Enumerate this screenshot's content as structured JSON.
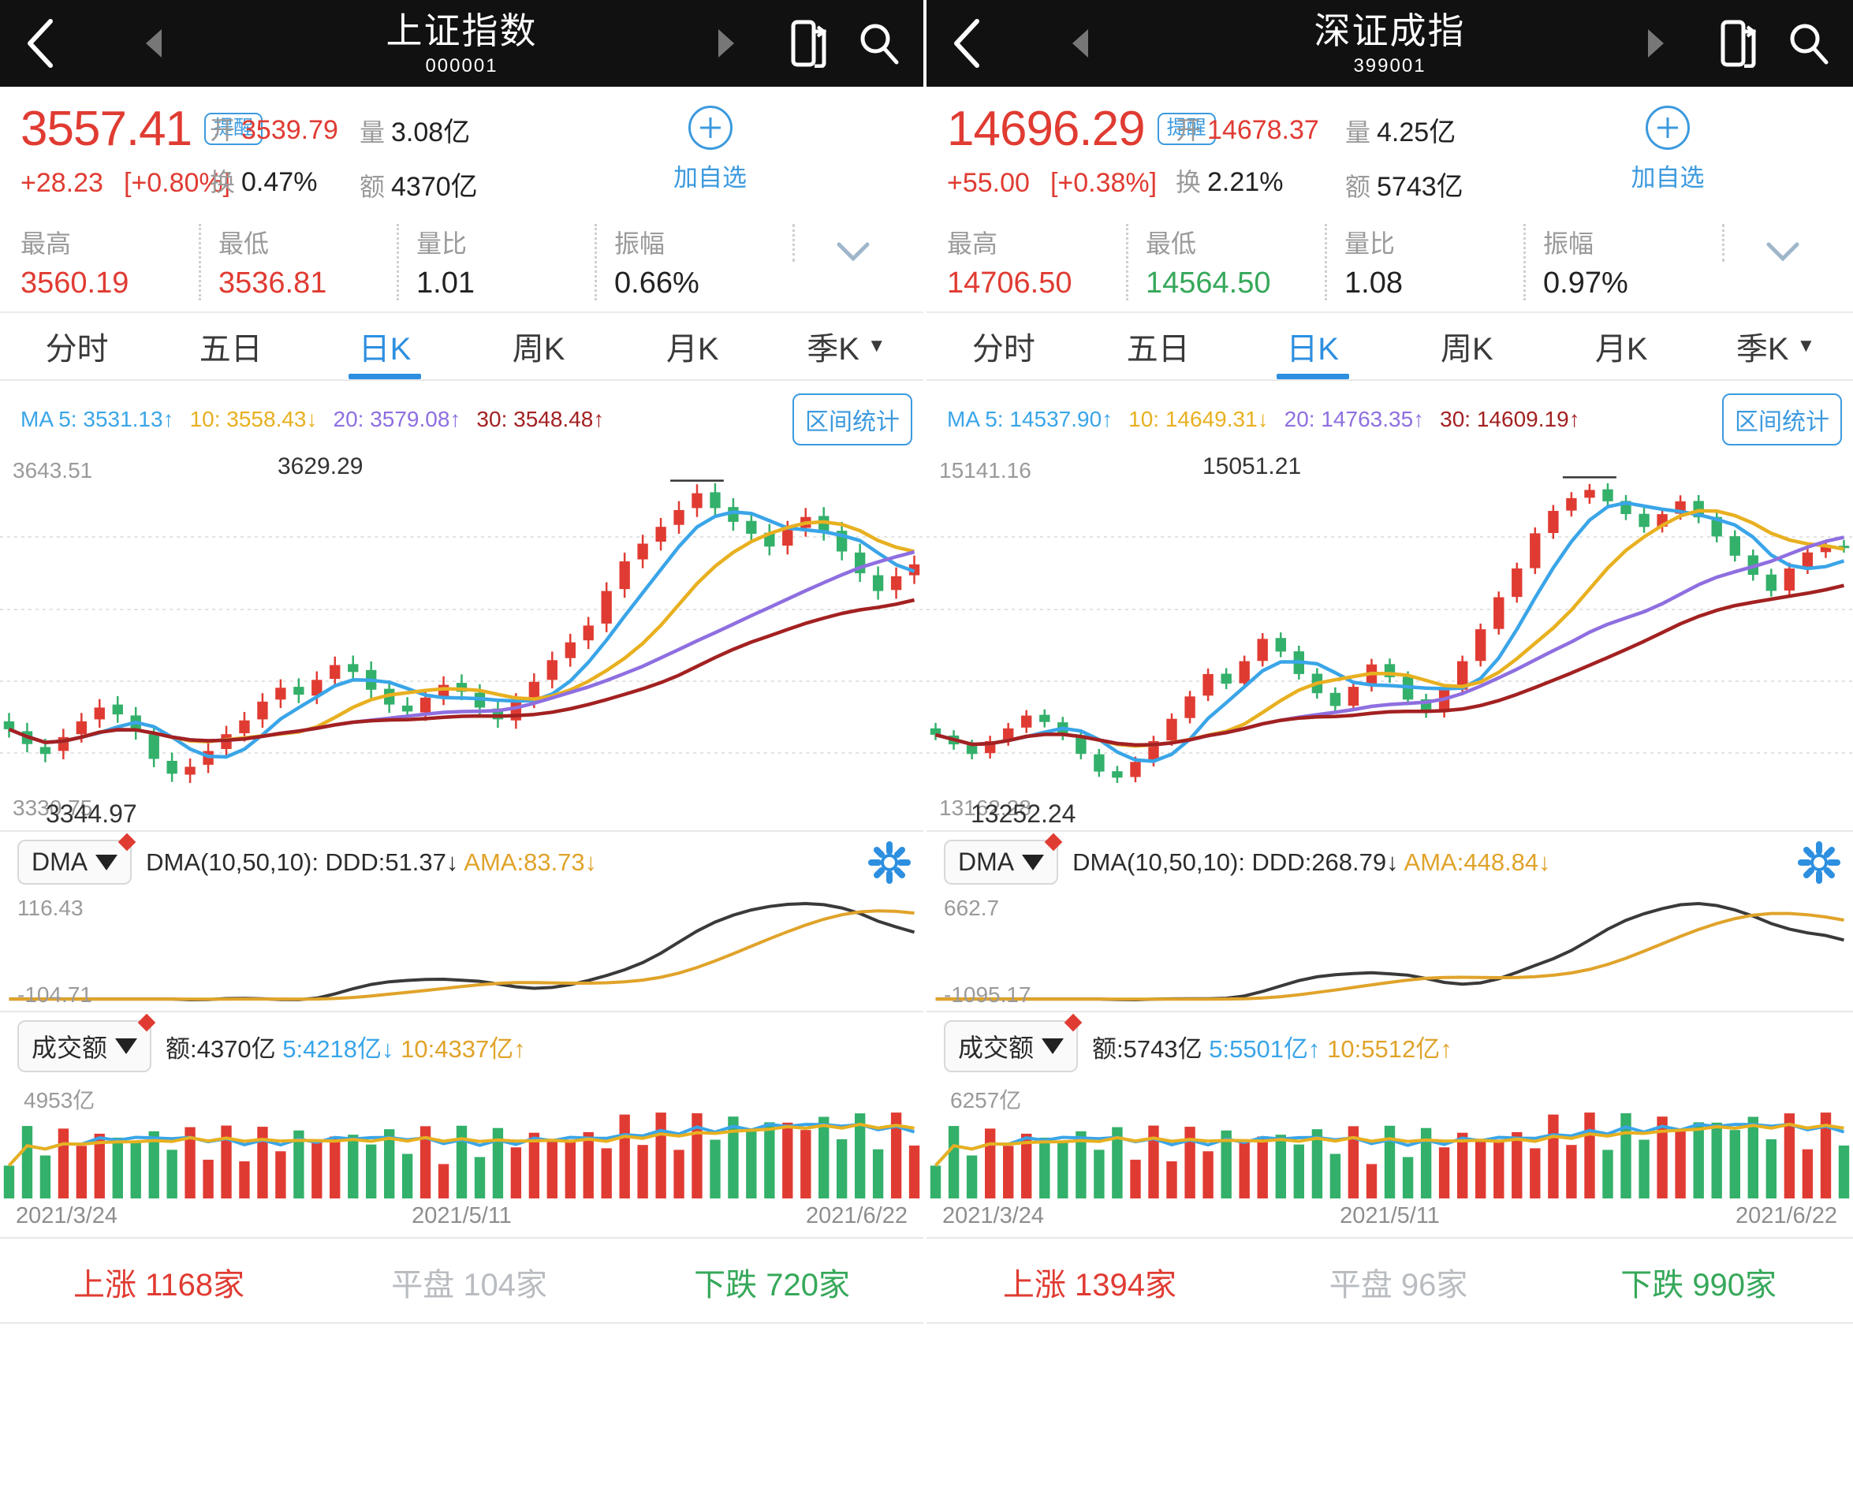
{
  "panels": [
    {
      "header": {
        "title": "上证指数",
        "code": "000001",
        "back_icon": "back-chevron-icon",
        "prev_icon": "prev-arrow-icon",
        "next_icon": "next-arrow-icon",
        "phone_icon": "phone-share-icon",
        "search_icon": "search-icon"
      },
      "quote": {
        "price": "3557.41",
        "alert_label": "提醒",
        "change": "+28.23",
        "change_pct": "[+0.80%]",
        "open_label": "开",
        "open_value": "3539.79",
        "turnover_label": "换",
        "turnover_value": "0.47%",
        "volume_label": "量",
        "volume_value": "3.08亿",
        "amount_label": "额",
        "amount_value": "4370亿",
        "add_label": "加自选",
        "color_up": "#e03b32",
        "color_down": "#36a85a"
      },
      "stats": [
        {
          "label": "最高",
          "value": "3560.19",
          "color": "red"
        },
        {
          "label": "最低",
          "value": "3536.81",
          "color": "red"
        },
        {
          "label": "量比",
          "value": "1.01",
          "color": "dark"
        },
        {
          "label": "振幅",
          "value": "0.66%",
          "color": "dark"
        }
      ],
      "tabs": [
        {
          "label": "分时",
          "active": false
        },
        {
          "label": "五日",
          "active": false
        },
        {
          "label": "日K",
          "active": true
        },
        {
          "label": "周K",
          "active": false
        },
        {
          "label": "月K",
          "active": false
        },
        {
          "label": "季K",
          "active": false,
          "caret": "▼"
        }
      ],
      "ma": {
        "ma5": "MA 5: 3531.13↑",
        "ma10": "10: 3558.43↓",
        "ma20": "20: 3579.08↑",
        "ma30": "30: 3548.48↑",
        "range_button": "区间统计"
      },
      "kchart": {
        "top_label": "3643.51",
        "bottom_label": "3330.75",
        "peak_label": "3629.29",
        "low_label": "3344.97"
      },
      "dma": {
        "button": "DMA",
        "text_prefix": "DMA(10,50,10):  DDD:51.37↓",
        "ama": "AMA:83.73↓",
        "top_label": "116.43",
        "bottom_label": "-104.71",
        "gear_icon": "gear-icon"
      },
      "volume": {
        "button": "成交额",
        "total": "额:4370亿",
        "v5": "5:4218亿↓",
        "v10": "10:4337亿↑",
        "top_label": "4953亿"
      },
      "dates": [
        "2021/3/24",
        "2021/5/11",
        "2021/6/22"
      ],
      "breadth": {
        "up": "上涨  1168家",
        "flat": "平盘  104家",
        "down": "下跌  720家"
      },
      "chart_data": {
        "type": "candlestick",
        "title": "上证指数 日K",
        "ylim": [
          3330.75,
          3643.51
        ],
        "xlabels": [
          "2021/3/24",
          "2021/5/11",
          "2021/6/22"
        ],
        "annotations": {
          "peak": 3629.29,
          "trough": 3344.97
        },
        "series": [
          {
            "name": "MA5",
            "color": "#3aa5e8",
            "last": 3531.13
          },
          {
            "name": "MA10",
            "color": "#e8b020",
            "last": 3558.43
          },
          {
            "name": "MA20",
            "color": "#8e6fe0",
            "last": 3579.08
          },
          {
            "name": "MA30",
            "color": "#a32121",
            "last": 3548.48
          }
        ],
        "closes": [
          3390,
          3375,
          3365,
          3382,
          3398,
          3412,
          3405,
          3388,
          3360,
          3345,
          3352,
          3368,
          3385,
          3399,
          3418,
          3432,
          3425,
          3440,
          3455,
          3448,
          3430,
          3415,
          3408,
          3422,
          3435,
          3428,
          3412,
          3400,
          3418,
          3438,
          3460,
          3478,
          3495,
          3530,
          3560,
          3578,
          3595,
          3612,
          3629,
          3614,
          3600,
          3588,
          3575,
          3592,
          3605,
          3590,
          3570,
          3548,
          3530,
          3545,
          3557
        ],
        "opens": [
          3398,
          3388,
          3372,
          3368,
          3385,
          3400,
          3415,
          3404,
          3385,
          3358,
          3344,
          3354,
          3370,
          3386,
          3400,
          3420,
          3433,
          3424,
          3441,
          3456,
          3450,
          3431,
          3414,
          3407,
          3423,
          3437,
          3427,
          3411,
          3399,
          3420,
          3440,
          3462,
          3480,
          3497,
          3532,
          3562,
          3580,
          3597,
          3614,
          3630,
          3615,
          3601,
          3589,
          3576,
          3594,
          3606,
          3591,
          3569,
          3546,
          3531,
          3546
        ]
      }
    },
    {
      "header": {
        "title": "深证成指",
        "code": "399001",
        "back_icon": "back-chevron-icon",
        "prev_icon": "prev-arrow-icon",
        "next_icon": "next-arrow-icon",
        "phone_icon": "phone-share-icon",
        "search_icon": "search-icon"
      },
      "quote": {
        "price": "14696.29",
        "alert_label": "提醒",
        "change": "+55.00",
        "change_pct": "[+0.38%]",
        "open_label": "开",
        "open_value": "14678.37",
        "turnover_label": "换",
        "turnover_value": "2.21%",
        "volume_label": "量",
        "volume_value": "4.25亿",
        "amount_label": "额",
        "amount_value": "5743亿",
        "add_label": "加自选",
        "color_up": "#e03b32",
        "color_down": "#36a85a"
      },
      "stats": [
        {
          "label": "最高",
          "value": "14706.50",
          "color": "red"
        },
        {
          "label": "最低",
          "value": "14564.50",
          "color": "green"
        },
        {
          "label": "量比",
          "value": "1.08",
          "color": "dark"
        },
        {
          "label": "振幅",
          "value": "0.97%",
          "color": "dark"
        }
      ],
      "tabs": [
        {
          "label": "分时",
          "active": false
        },
        {
          "label": "五日",
          "active": false
        },
        {
          "label": "日K",
          "active": true
        },
        {
          "label": "周K",
          "active": false
        },
        {
          "label": "月K",
          "active": false
        },
        {
          "label": "季K",
          "active": false,
          "caret": "▼"
        }
      ],
      "ma": {
        "ma5": "MA 5: 14537.90↑",
        "ma10": "10: 14649.31↓",
        "ma20": "20: 14763.35↑",
        "ma30": "30: 14609.19↑",
        "range_button": "区间统计"
      },
      "kchart": {
        "top_label": "15141.16",
        "bottom_label": "13162.28",
        "peak_label": "15051.21",
        "low_label": "13252.24"
      },
      "dma": {
        "button": "DMA",
        "text_prefix": "DMA(10,50,10):  DDD:268.79↓",
        "ama": "AMA:448.84↓",
        "top_label": "662.7",
        "bottom_label": "-1095.17",
        "gear_icon": "gear-icon"
      },
      "volume": {
        "button": "成交额",
        "total": "额:5743亿",
        "v5": "5:5501亿↑",
        "v10": "10:5512亿↑",
        "top_label": "6257亿"
      },
      "dates": [
        "2021/3/24",
        "2021/5/11",
        "2021/6/22"
      ],
      "breadth": {
        "up": "上涨  1394家",
        "flat": "平盘  96家",
        "down": "下跌  990家"
      },
      "chart_data": {
        "type": "candlestick",
        "title": "深证成指 日K",
        "ylim": [
          13162.28,
          15141.16
        ],
        "xlabels": [
          "2021/3/24",
          "2021/5/11",
          "2021/6/22"
        ],
        "annotations": {
          "peak": 15051.21,
          "trough": 13252.24
        },
        "series": [
          {
            "name": "MA5",
            "color": "#3aa5e8",
            "last": 14537.9
          },
          {
            "name": "MA10",
            "color": "#e8b020",
            "last": 14649.31
          },
          {
            "name": "MA20",
            "color": "#8e6fe0",
            "last": 14763.35
          },
          {
            "name": "MA30",
            "color": "#a32121",
            "last": 14609.19
          }
        ],
        "closes": [
          13520,
          13460,
          13400,
          13480,
          13560,
          13640,
          13600,
          13520,
          13400,
          13290,
          13252,
          13350,
          13480,
          13620,
          13760,
          13900,
          13840,
          13980,
          14120,
          14040,
          13900,
          13780,
          13700,
          13820,
          13960,
          13880,
          13740,
          13660,
          13800,
          13980,
          14180,
          14380,
          14560,
          14780,
          14920,
          15000,
          15051,
          14980,
          14900,
          14820,
          14900,
          14980,
          14880,
          14760,
          14640,
          14520,
          14420,
          14560,
          14660,
          14700,
          14696
        ],
        "opens": [
          13560,
          13515,
          13455,
          13405,
          13485,
          13565,
          13645,
          13598,
          13518,
          13398,
          13292,
          13256,
          13355,
          13485,
          13625,
          13765,
          13902,
          13842,
          13982,
          14125,
          14042,
          13902,
          13782,
          13702,
          13825,
          13962,
          13882,
          13742,
          13662,
          13802,
          13982,
          14182,
          14382,
          14562,
          14782,
          14922,
          15002,
          15055,
          14982,
          14902,
          14822,
          14902,
          14982,
          14882,
          14762,
          14642,
          14522,
          14422,
          14562,
          14662,
          14702
        ]
      }
    }
  ]
}
